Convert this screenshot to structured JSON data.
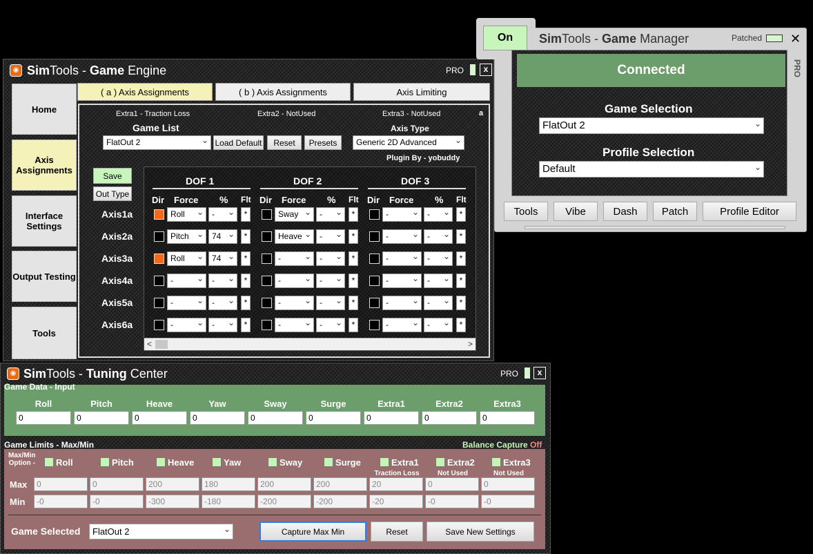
{
  "game_engine": {
    "title_bold_prefix": "Sim",
    "title_mid": "Tools - ",
    "title_bold": "Game",
    "title_suffix": " Engine",
    "pro_label": "PRO",
    "close_label": "x",
    "sidebar": [
      {
        "label": "Home"
      },
      {
        "label": "Axis Assignments"
      },
      {
        "label": "Interface Settings"
      },
      {
        "label": "Output Testing"
      },
      {
        "label": "Tools"
      }
    ],
    "tabs": [
      {
        "label": "( a ) Axis Assignments"
      },
      {
        "label": "( b ) Axis Assignments"
      },
      {
        "label": "Axis Limiting"
      }
    ],
    "extra1": "Extra1 - Traction Loss",
    "extra2": "Extra2 - NotUsed",
    "extra3": "Extra3 - NotUsed",
    "corner_letter": "a",
    "game_list_label": "Game List",
    "game_list_value": "FlatOut 2",
    "load_default_label": "Load Default",
    "reset_label": "Reset",
    "presets_label": "Presets",
    "axis_type_label": "Axis Type",
    "axis_type_value": "Generic 2D Advanced",
    "plugin_by": "Plugin By - yobuddy",
    "save_label": "Save",
    "out_type_label": "Out Type",
    "dof_headers": [
      "DOF 1",
      "DOF 2",
      "DOF 3"
    ],
    "col_headers": {
      "dir": "Dir",
      "force": "Force",
      "pct": "%",
      "flt": "Flt"
    },
    "flt_mark": "*",
    "axes": [
      {
        "name": "Axis1a",
        "dof": [
          {
            "dir": true,
            "force": "Roll",
            "pct": "-"
          },
          {
            "dir": false,
            "force": "Sway",
            "pct": "-"
          },
          {
            "dir": false,
            "force": "-",
            "pct": "-"
          }
        ]
      },
      {
        "name": "Axis2a",
        "dof": [
          {
            "dir": false,
            "force": "Pitch",
            "pct": "74"
          },
          {
            "dir": false,
            "force": "Heave",
            "pct": "-"
          },
          {
            "dir": false,
            "force": "-",
            "pct": "-"
          }
        ]
      },
      {
        "name": "Axis3a",
        "dof": [
          {
            "dir": true,
            "force": "Roll",
            "pct": "74"
          },
          {
            "dir": false,
            "force": "-",
            "pct": "-"
          },
          {
            "dir": false,
            "force": "-",
            "pct": "-"
          }
        ]
      },
      {
        "name": "Axis4a",
        "dof": [
          {
            "dir": false,
            "force": "-",
            "pct": "-"
          },
          {
            "dir": false,
            "force": "-",
            "pct": "-"
          },
          {
            "dir": false,
            "force": "-",
            "pct": "-"
          }
        ]
      },
      {
        "name": "Axis5a",
        "dof": [
          {
            "dir": false,
            "force": "-",
            "pct": "-"
          },
          {
            "dir": false,
            "force": "-",
            "pct": "-"
          },
          {
            "dir": false,
            "force": "-",
            "pct": "-"
          }
        ]
      },
      {
        "name": "Axis6a",
        "dof": [
          {
            "dir": false,
            "force": "-",
            "pct": "-"
          },
          {
            "dir": false,
            "force": "-",
            "pct": "-"
          },
          {
            "dir": false,
            "force": "-",
            "pct": "-"
          }
        ]
      }
    ],
    "scroll_left": "<",
    "scroll_right": ">"
  },
  "game_manager": {
    "on_label": "On",
    "title_bold_prefix": "Sim",
    "title_mid": "Tools - ",
    "title_bold": "Game",
    "title_suffix": " Manager",
    "patched_label": "Patched",
    "close_label": "✕",
    "pro_vertical": "PRO",
    "status": "Connected",
    "game_selection_label": "Game Selection",
    "game_selection_value": "FlatOut 2",
    "profile_selection_label": "Profile Selection",
    "profile_selection_value": "Default",
    "buttons": [
      {
        "label": "Tools"
      },
      {
        "label": "Vibe"
      },
      {
        "label": "Dash"
      },
      {
        "label": "Patch"
      },
      {
        "label": "Profile Editor"
      }
    ]
  },
  "tuning_center": {
    "title_bold_prefix": "Sim",
    "title_mid": "Tools - ",
    "title_bold": "Tuning",
    "title_suffix": " Center",
    "pro_label": "PRO",
    "close_label": "x",
    "input_section_label": "Game Data - Input",
    "channels": [
      "Roll",
      "Pitch",
      "Heave",
      "Yaw",
      "Sway",
      "Surge",
      "Extra1",
      "Extra2",
      "Extra3"
    ],
    "inputs": [
      "0",
      "0",
      "0",
      "0",
      "0",
      "0",
      "0",
      "0",
      "0"
    ],
    "limits_section_label": "Game Limits - Max/Min",
    "balance_label": "Balance Capture",
    "balance_state": "Off",
    "maxmin_label_1": "Max/Min",
    "maxmin_label_2": "Option -",
    "extra_notes": [
      "Traction Loss",
      "Not Used",
      "Not Used"
    ],
    "max_label": "Max",
    "min_label": "Min",
    "max_values": [
      "0",
      "0",
      "200",
      "180",
      "200",
      "200",
      "20",
      "0",
      "0"
    ],
    "min_values": [
      "-0",
      "-0",
      "-300",
      "-180",
      "-200",
      "-200",
      "-20",
      "-0",
      "-0"
    ],
    "game_selected_label": "Game Selected",
    "game_selected_value": "FlatOut 2",
    "capture_label": "Capture Max Min",
    "reset_label": "Reset",
    "save_label": "Save New Settings"
  }
}
